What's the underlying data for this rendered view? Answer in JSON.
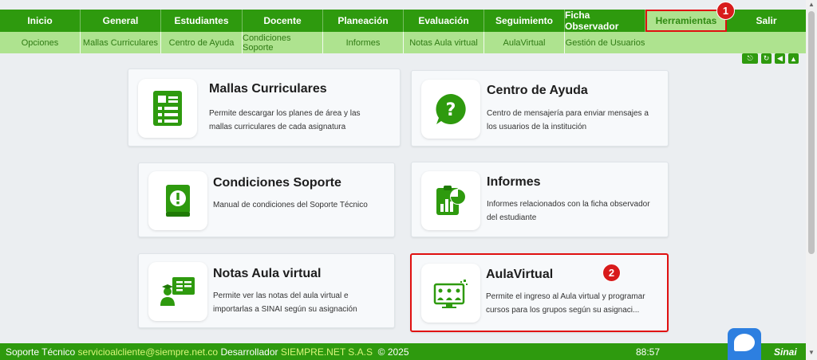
{
  "topnav": {
    "items": [
      "Inicio",
      "General",
      "Estudiantes",
      "Docente",
      "Planeación",
      "Evaluación",
      "Seguimiento",
      "Ficha Observador",
      "Herramientas",
      "Salir"
    ]
  },
  "subnav": {
    "items": [
      "Opciones",
      "Mallas Curriculares",
      "Centro de Ayuda",
      "Condiciones Soporte",
      "Informes",
      "Notas Aula virtual",
      "AulaVirtual",
      "Gestión de Usuarios"
    ]
  },
  "annotations": {
    "badge1": "1",
    "badge2": "2"
  },
  "cards": {
    "mallas": {
      "title": "Mallas Curriculares",
      "line1": "Permite descargar los planes de área y las",
      "line2": "mallas curriculares de cada asignatura",
      "icon": "document-list-icon"
    },
    "ayuda": {
      "title": "Centro de Ayuda",
      "line1": "Centro de mensajería para enviar mensajes a",
      "line2": "los usuarios de la institución",
      "icon": "question-bubble-icon"
    },
    "soporte": {
      "title": "Condiciones Soporte",
      "line1": "Manual de condiciones del Soporte Técnico",
      "icon": "manual-book-icon"
    },
    "informes": {
      "title": "Informes",
      "line1": "Informes relacionados con la ficha observador",
      "line2": "del estudiante",
      "icon": "report-chart-icon"
    },
    "notas": {
      "title": "Notas Aula virtual",
      "line1": "Permite ver las notas del aula virtual e",
      "line2": "importarlas a SINAI según su asignación",
      "icon": "teacher-board-icon"
    },
    "aula": {
      "title": "AulaVirtual",
      "line1": "Permite el ingreso al Aula virtual y programar",
      "line2": "cursos para los grupos según su asignaci...",
      "icon": "virtual-classroom-icon"
    }
  },
  "footer": {
    "support_label": "Soporte Técnico",
    "email": "servicioalcliente@siempre.net.co",
    "developer_label": "Desarrollador",
    "company": "SIEMPRE.NET S.A.S",
    "copyright": "© 2025",
    "timer": "88:57",
    "logo": "Sinai"
  },
  "colors": {
    "primary": "#2e9a0e",
    "subnav": "#aee38f",
    "highlight": "#e01010",
    "badge": "#d81b1b"
  }
}
